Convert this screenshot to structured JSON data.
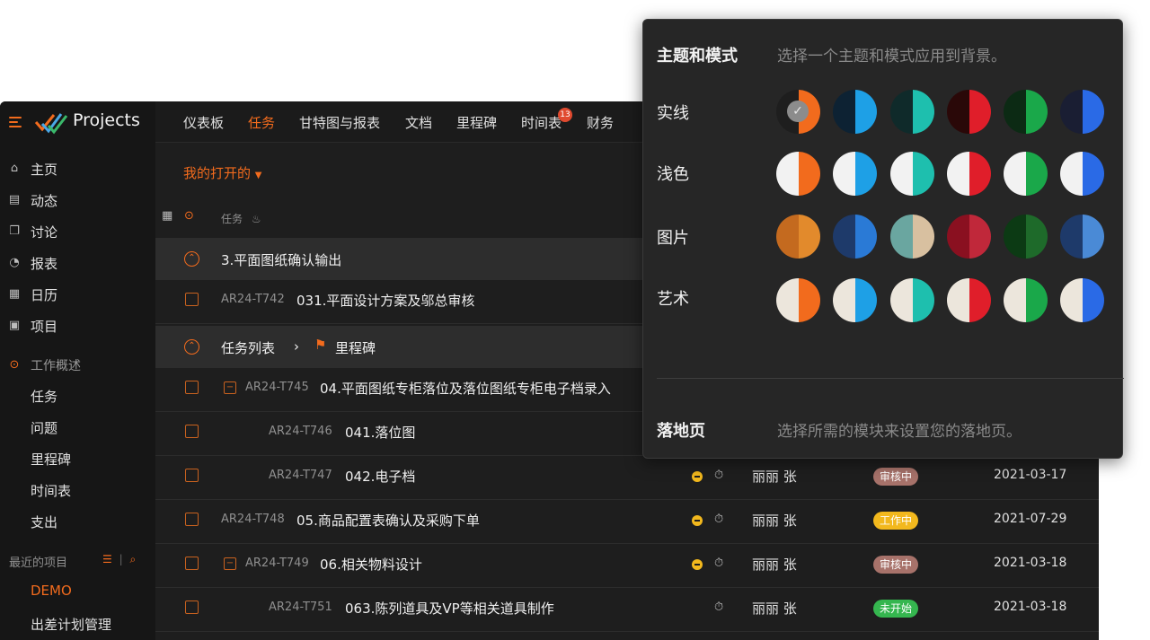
{
  "app": {
    "brand": "Projects",
    "sidebar": {
      "items": [
        {
          "label": "主页",
          "icon": "home-icon"
        },
        {
          "label": "动态",
          "icon": "feed-icon"
        },
        {
          "label": "讨论",
          "icon": "chat-icon"
        },
        {
          "label": "报表",
          "icon": "report-icon"
        },
        {
          "label": "日历",
          "icon": "calendar-icon"
        },
        {
          "label": "项目",
          "icon": "briefcase-icon"
        }
      ],
      "overview_label": "工作概述",
      "sub_items": [
        "任务",
        "问题",
        "里程碑",
        "时间表",
        "支出"
      ],
      "recent_label": "最近的项目",
      "recent_projects": [
        "DEMO",
        "出差计划管理"
      ]
    },
    "tabs": [
      "仪表板",
      "任务",
      "甘特图与报表",
      "文档",
      "里程碑",
      "时间表",
      "财务"
    ],
    "active_tab": "任务",
    "timesheet_badge": "13",
    "filter_label": "我的打开的",
    "column_task_label": "任务",
    "groups": [
      {
        "title": "3.平面图纸确认输出"
      },
      {
        "title": "任务列表",
        "milestone": "里程碑"
      }
    ],
    "rows": [
      {
        "id": "AR24-T742",
        "title": "031.平面设计方案及邬总审核"
      },
      {
        "id": "AR24-T745",
        "title": "04.平面图纸专柜落位及落位图纸专柜电子档录入"
      },
      {
        "id": "AR24-T746",
        "title": "041.落位图"
      },
      {
        "id": "AR24-T747",
        "title": "042.电子档",
        "owner": "丽丽 张",
        "status": "审核中",
        "date": "2021-03-17"
      },
      {
        "id": "AR24-T748",
        "title": "05.商品配置表确认及采购下单",
        "owner": "丽丽 张",
        "status": "工作中",
        "date": "2021-07-29"
      },
      {
        "id": "AR24-T749",
        "title": "06.相关物料设计",
        "owner": "丽丽 张",
        "status": "审核中",
        "date": "2021-03-18"
      },
      {
        "id": "AR24-T751",
        "title": "063.陈列道具及VP等相关道具制作",
        "owner": "丽丽 张",
        "status": "未开始",
        "date": "2021-03-18"
      }
    ],
    "status_colors": {
      "审核中": "#a7726a",
      "工作中": "#f2b81d",
      "未开始": "#35b64f"
    }
  },
  "theme_panel": {
    "title": "主题和模式",
    "description": "选择一个主题和模式应用到背景。",
    "rows": [
      {
        "label": "实线",
        "swatches": [
          [
            "#1e1e1e",
            "#f26b1d"
          ],
          [
            "#0d2233",
            "#1ea0e6"
          ],
          [
            "#0f2a2a",
            "#1ebfae"
          ],
          [
            "#2a0808",
            "#e01e2a"
          ],
          [
            "#0c2a14",
            "#1aa84a"
          ],
          [
            "#1a1e33",
            "#2a6ae6"
          ]
        ]
      },
      {
        "label": "浅色",
        "swatches": [
          [
            "#f2f2f2",
            "#f26b1d"
          ],
          [
            "#f2f2f2",
            "#1ea0e6"
          ],
          [
            "#f2f2f2",
            "#1ebfae"
          ],
          [
            "#f2f2f2",
            "#e01e2a"
          ],
          [
            "#f2f2f2",
            "#1aa84a"
          ],
          [
            "#f2f2f2",
            "#2a6ae6"
          ]
        ]
      },
      {
        "label": "图片",
        "swatches": [
          [
            "#c46a1f",
            "#e28a2c"
          ],
          [
            "#1e3a6a",
            "#2a7ad6"
          ],
          [
            "#6aa6a0",
            "#d8c0a0"
          ],
          [
            "#8a1020",
            "#c0283a"
          ],
          [
            "#0c3a14",
            "#1e6a2a"
          ],
          [
            "#1e3a6a",
            "#4a8ad6"
          ]
        ]
      },
      {
        "label": "艺术",
        "swatches": [
          [
            "#ece6dc",
            "#f26b1d"
          ],
          [
            "#ece6dc",
            "#1ea0e6"
          ],
          [
            "#ece6dc",
            "#1ebfae"
          ],
          [
            "#ece6dc",
            "#e01e2a"
          ],
          [
            "#ece6dc",
            "#1aa84a"
          ],
          [
            "#ece6dc",
            "#2a6ae6"
          ]
        ]
      }
    ],
    "landing_title": "落地页",
    "landing_description": "选择所需的模块来设置您的落地页。"
  }
}
